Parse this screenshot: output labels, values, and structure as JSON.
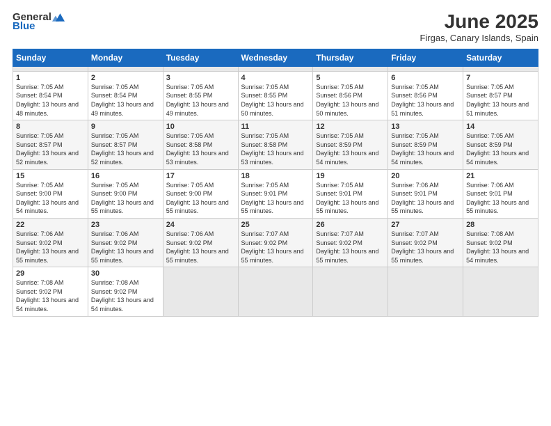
{
  "header": {
    "logo": {
      "general": "General",
      "blue": "Blue",
      "tagline": ""
    },
    "title": "June 2025",
    "subtitle": "Firgas, Canary Islands, Spain"
  },
  "calendar": {
    "days": [
      "Sunday",
      "Monday",
      "Tuesday",
      "Wednesday",
      "Thursday",
      "Friday",
      "Saturday"
    ],
    "weeks": [
      [
        {
          "day": "",
          "empty": true
        },
        {
          "day": "",
          "empty": true
        },
        {
          "day": "",
          "empty": true
        },
        {
          "day": "",
          "empty": true
        },
        {
          "day": "",
          "empty": true
        },
        {
          "day": "",
          "empty": true
        },
        {
          "day": "",
          "empty": true
        }
      ],
      [
        {
          "num": "1",
          "sunrise": "Sunrise: 7:05 AM",
          "sunset": "Sunset: 8:54 PM",
          "daylight": "Daylight: 13 hours and 48 minutes."
        },
        {
          "num": "2",
          "sunrise": "Sunrise: 7:05 AM",
          "sunset": "Sunset: 8:54 PM",
          "daylight": "Daylight: 13 hours and 49 minutes."
        },
        {
          "num": "3",
          "sunrise": "Sunrise: 7:05 AM",
          "sunset": "Sunset: 8:55 PM",
          "daylight": "Daylight: 13 hours and 49 minutes."
        },
        {
          "num": "4",
          "sunrise": "Sunrise: 7:05 AM",
          "sunset": "Sunset: 8:55 PM",
          "daylight": "Daylight: 13 hours and 50 minutes."
        },
        {
          "num": "5",
          "sunrise": "Sunrise: 7:05 AM",
          "sunset": "Sunset: 8:56 PM",
          "daylight": "Daylight: 13 hours and 50 minutes."
        },
        {
          "num": "6",
          "sunrise": "Sunrise: 7:05 AM",
          "sunset": "Sunset: 8:56 PM",
          "daylight": "Daylight: 13 hours and 51 minutes."
        },
        {
          "num": "7",
          "sunrise": "Sunrise: 7:05 AM",
          "sunset": "Sunset: 8:57 PM",
          "daylight": "Daylight: 13 hours and 51 minutes."
        }
      ],
      [
        {
          "num": "8",
          "sunrise": "Sunrise: 7:05 AM",
          "sunset": "Sunset: 8:57 PM",
          "daylight": "Daylight: 13 hours and 52 minutes."
        },
        {
          "num": "9",
          "sunrise": "Sunrise: 7:05 AM",
          "sunset": "Sunset: 8:57 PM",
          "daylight": "Daylight: 13 hours and 52 minutes."
        },
        {
          "num": "10",
          "sunrise": "Sunrise: 7:05 AM",
          "sunset": "Sunset: 8:58 PM",
          "daylight": "Daylight: 13 hours and 53 minutes."
        },
        {
          "num": "11",
          "sunrise": "Sunrise: 7:05 AM",
          "sunset": "Sunset: 8:58 PM",
          "daylight": "Daylight: 13 hours and 53 minutes."
        },
        {
          "num": "12",
          "sunrise": "Sunrise: 7:05 AM",
          "sunset": "Sunset: 8:59 PM",
          "daylight": "Daylight: 13 hours and 54 minutes."
        },
        {
          "num": "13",
          "sunrise": "Sunrise: 7:05 AM",
          "sunset": "Sunset: 8:59 PM",
          "daylight": "Daylight: 13 hours and 54 minutes."
        },
        {
          "num": "14",
          "sunrise": "Sunrise: 7:05 AM",
          "sunset": "Sunset: 8:59 PM",
          "daylight": "Daylight: 13 hours and 54 minutes."
        }
      ],
      [
        {
          "num": "15",
          "sunrise": "Sunrise: 7:05 AM",
          "sunset": "Sunset: 9:00 PM",
          "daylight": "Daylight: 13 hours and 54 minutes."
        },
        {
          "num": "16",
          "sunrise": "Sunrise: 7:05 AM",
          "sunset": "Sunset: 9:00 PM",
          "daylight": "Daylight: 13 hours and 55 minutes."
        },
        {
          "num": "17",
          "sunrise": "Sunrise: 7:05 AM",
          "sunset": "Sunset: 9:00 PM",
          "daylight": "Daylight: 13 hours and 55 minutes."
        },
        {
          "num": "18",
          "sunrise": "Sunrise: 7:05 AM",
          "sunset": "Sunset: 9:01 PM",
          "daylight": "Daylight: 13 hours and 55 minutes."
        },
        {
          "num": "19",
          "sunrise": "Sunrise: 7:05 AM",
          "sunset": "Sunset: 9:01 PM",
          "daylight": "Daylight: 13 hours and 55 minutes."
        },
        {
          "num": "20",
          "sunrise": "Sunrise: 7:06 AM",
          "sunset": "Sunset: 9:01 PM",
          "daylight": "Daylight: 13 hours and 55 minutes."
        },
        {
          "num": "21",
          "sunrise": "Sunrise: 7:06 AM",
          "sunset": "Sunset: 9:01 PM",
          "daylight": "Daylight: 13 hours and 55 minutes."
        }
      ],
      [
        {
          "num": "22",
          "sunrise": "Sunrise: 7:06 AM",
          "sunset": "Sunset: 9:02 PM",
          "daylight": "Daylight: 13 hours and 55 minutes."
        },
        {
          "num": "23",
          "sunrise": "Sunrise: 7:06 AM",
          "sunset": "Sunset: 9:02 PM",
          "daylight": "Daylight: 13 hours and 55 minutes."
        },
        {
          "num": "24",
          "sunrise": "Sunrise: 7:06 AM",
          "sunset": "Sunset: 9:02 PM",
          "daylight": "Daylight: 13 hours and 55 minutes."
        },
        {
          "num": "25",
          "sunrise": "Sunrise: 7:07 AM",
          "sunset": "Sunset: 9:02 PM",
          "daylight": "Daylight: 13 hours and 55 minutes."
        },
        {
          "num": "26",
          "sunrise": "Sunrise: 7:07 AM",
          "sunset": "Sunset: 9:02 PM",
          "daylight": "Daylight: 13 hours and 55 minutes."
        },
        {
          "num": "27",
          "sunrise": "Sunrise: 7:07 AM",
          "sunset": "Sunset: 9:02 PM",
          "daylight": "Daylight: 13 hours and 55 minutes."
        },
        {
          "num": "28",
          "sunrise": "Sunrise: 7:08 AM",
          "sunset": "Sunset: 9:02 PM",
          "daylight": "Daylight: 13 hours and 54 minutes."
        }
      ],
      [
        {
          "num": "29",
          "sunrise": "Sunrise: 7:08 AM",
          "sunset": "Sunset: 9:02 PM",
          "daylight": "Daylight: 13 hours and 54 minutes."
        },
        {
          "num": "30",
          "sunrise": "Sunrise: 7:08 AM",
          "sunset": "Sunset: 9:02 PM",
          "daylight": "Daylight: 13 hours and 54 minutes."
        },
        {
          "empty": true
        },
        {
          "empty": true
        },
        {
          "empty": true
        },
        {
          "empty": true
        },
        {
          "empty": true
        }
      ]
    ]
  }
}
